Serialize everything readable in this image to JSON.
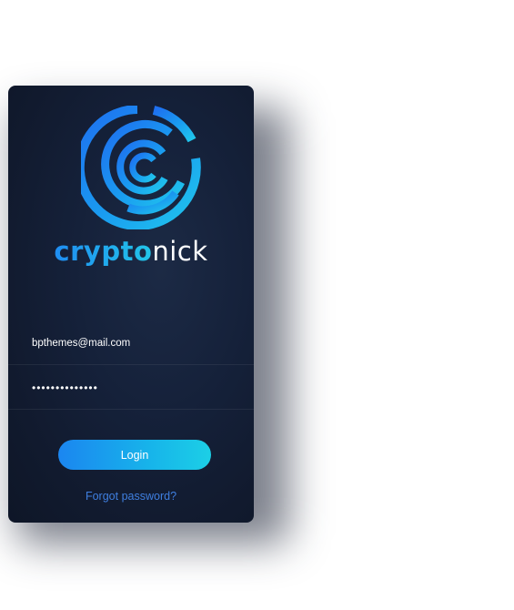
{
  "brand": {
    "name_strong": "crypto",
    "name_light": "nick",
    "logo_icon": "maze-c-logo-icon",
    "accent_start": "#1b86f0",
    "accent_end": "#1ccfe6"
  },
  "login_form": {
    "email_value": "bpthemes@mail.com",
    "password_value": "••••••••••••••",
    "login_label": "Login",
    "forgot_label": "Forgot password?"
  },
  "colors": {
    "card_background": "#131d33",
    "link": "#3f7fe0"
  }
}
